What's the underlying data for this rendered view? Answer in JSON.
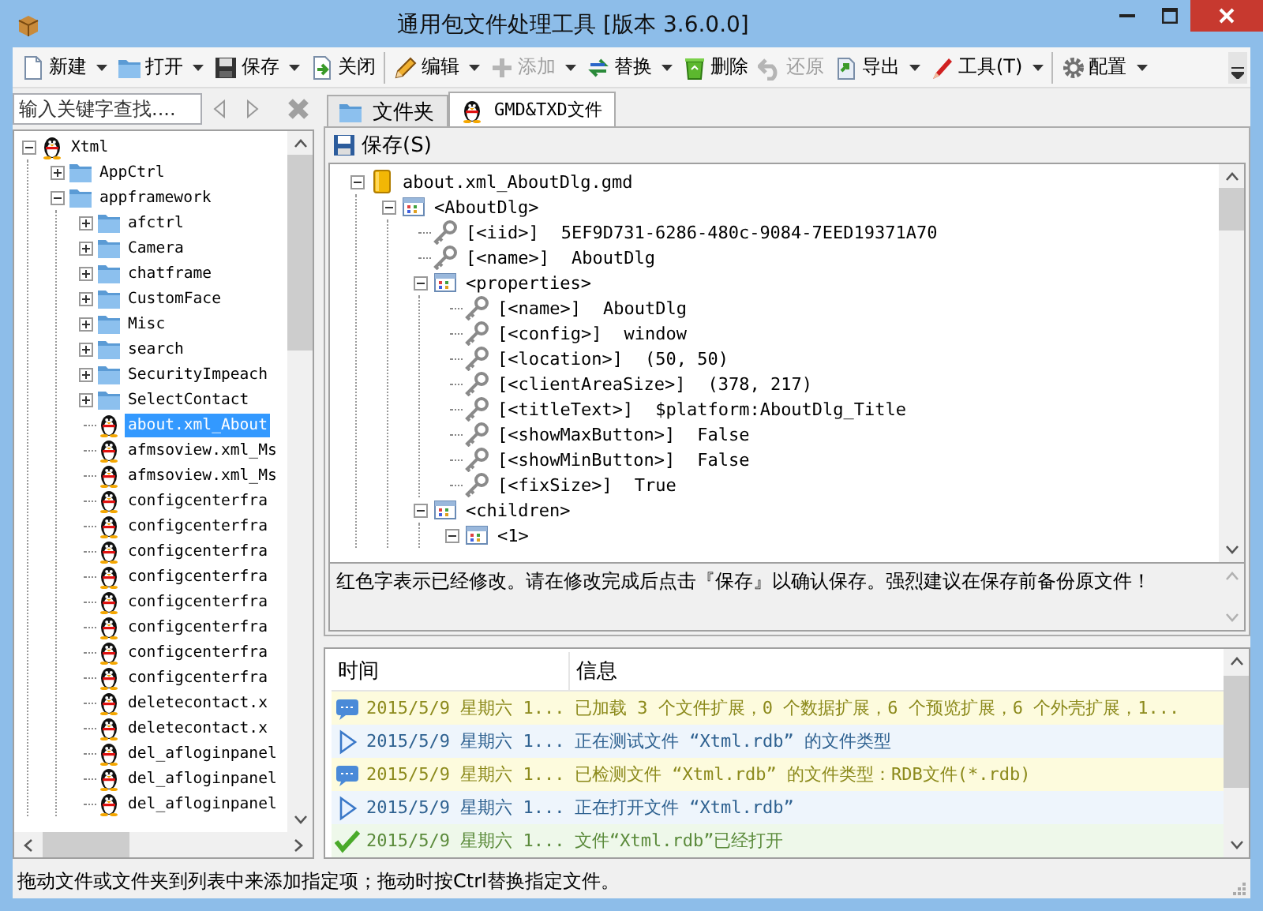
{
  "window": {
    "title": "通用包文件处理工具 [版本 3.6.0.0]"
  },
  "toolbar": {
    "groups": [
      [
        {
          "label": "新建",
          "has_menu": true,
          "disabled": false
        },
        {
          "label": "打开",
          "has_menu": true,
          "disabled": false
        },
        {
          "label": "保存",
          "has_menu": true,
          "disabled": false
        },
        {
          "label": "关闭",
          "has_menu": false,
          "disabled": false
        }
      ],
      [
        {
          "label": "编辑",
          "has_menu": true,
          "disabled": false
        },
        {
          "label": "添加",
          "has_menu": true,
          "disabled": true
        },
        {
          "label": "替换",
          "has_menu": true,
          "disabled": false
        },
        {
          "label": "删除",
          "has_menu": false,
          "disabled": false
        },
        {
          "label": "还原",
          "has_menu": false,
          "disabled": true
        },
        {
          "label": "导出",
          "has_menu": true,
          "disabled": false
        },
        {
          "label": "工具(T)",
          "has_menu": true,
          "disabled": false
        }
      ],
      [
        {
          "label": "配置",
          "has_menu": true,
          "disabled": false
        }
      ]
    ]
  },
  "search": {
    "placeholder": "输入关键字查找...."
  },
  "sidebar": {
    "tree": [
      {
        "kind": "penguin",
        "label": "Xtml",
        "expanded": true,
        "selected": false,
        "children": [
          {
            "kind": "folder",
            "label": "AppCtrl",
            "expanded": false,
            "selected": false
          },
          {
            "kind": "folder",
            "label": "appframework",
            "expanded": true,
            "selected": false,
            "children": [
              {
                "kind": "folder",
                "label": "afctrl",
                "expanded": false,
                "selected": false
              },
              {
                "kind": "folder",
                "label": "Camera",
                "expanded": false,
                "selected": false
              },
              {
                "kind": "folder",
                "label": "chatframe",
                "expanded": false,
                "selected": false
              },
              {
                "kind": "folder",
                "label": "CustomFace",
                "expanded": false,
                "selected": false
              },
              {
                "kind": "folder",
                "label": "Misc",
                "expanded": false,
                "selected": false
              },
              {
                "kind": "folder",
                "label": "search",
                "expanded": false,
                "selected": false
              },
              {
                "kind": "folder",
                "label": "SecurityImpeach",
                "expanded": false,
                "selected": false
              },
              {
                "kind": "folder",
                "label": "SelectContact",
                "expanded": false,
                "selected": false
              },
              {
                "kind": "penguin",
                "label": "about.xml_About",
                "selected": true
              },
              {
                "kind": "penguin",
                "label": "afmsoview.xml_Ms",
                "selected": false
              },
              {
                "kind": "penguin",
                "label": "afmsoview.xml_Ms",
                "selected": false
              },
              {
                "kind": "penguin",
                "label": "configcenterfra",
                "selected": false
              },
              {
                "kind": "penguin",
                "label": "configcenterfra",
                "selected": false
              },
              {
                "kind": "penguin",
                "label": "configcenterfra",
                "selected": false
              },
              {
                "kind": "penguin",
                "label": "configcenterfra",
                "selected": false
              },
              {
                "kind": "penguin",
                "label": "configcenterfra",
                "selected": false
              },
              {
                "kind": "penguin",
                "label": "configcenterfra",
                "selected": false
              },
              {
                "kind": "penguin",
                "label": "configcenterfra",
                "selected": false
              },
              {
                "kind": "penguin",
                "label": "configcenterfra",
                "selected": false
              },
              {
                "kind": "penguin",
                "label": "deletecontact.x",
                "selected": false
              },
              {
                "kind": "penguin",
                "label": "deletecontact.x",
                "selected": false
              },
              {
                "kind": "penguin",
                "label": "del_afloginpanel",
                "selected": false
              },
              {
                "kind": "penguin",
                "label": "del_afloginpanel",
                "selected": false
              },
              {
                "kind": "penguin",
                "label": "del_afloginpanel",
                "selected": false
              }
            ]
          }
        ]
      }
    ]
  },
  "tabs": [
    {
      "label": "文件夹",
      "selected": false
    },
    {
      "label": "GMD&TXD文件",
      "selected": true
    }
  ],
  "editor": {
    "save_button": "保存(S)",
    "tree": [
      {
        "kind": "file",
        "label": "about.xml_AboutDlg.gmd",
        "expanded": true,
        "selected": false,
        "children": [
          {
            "kind": "node",
            "label": "<AboutDlg>",
            "expanded": true,
            "selected": false,
            "children": [
              {
                "kind": "key",
                "label": "[<iid>]",
                "value": "5EF9D731-6286-480c-9084-7EED19371A70",
                "selected": false
              },
              {
                "kind": "key",
                "label": "[<name>]",
                "value": "AboutDlg",
                "selected": false
              },
              {
                "kind": "node",
                "label": "<properties>",
                "expanded": true,
                "selected": false,
                "children": [
                  {
                    "kind": "key",
                    "label": "[<name>]",
                    "value": "AboutDlg",
                    "selected": false
                  },
                  {
                    "kind": "key",
                    "label": "[<config>]",
                    "value": "window",
                    "selected": false
                  },
                  {
                    "kind": "key",
                    "label": "[<location>]",
                    "value": "(50, 50)",
                    "selected": false
                  },
                  {
                    "kind": "key",
                    "label": "[<clientAreaSize>]",
                    "value": "(378, 217)",
                    "selected": false
                  },
                  {
                    "kind": "key",
                    "label": "[<titleText>]",
                    "value": "$platform:AboutDlg_Title",
                    "selected": false
                  },
                  {
                    "kind": "key",
                    "label": "[<showMaxButton>]",
                    "value": "False",
                    "selected": false
                  },
                  {
                    "kind": "key",
                    "label": "[<showMinButton>]",
                    "value": "False",
                    "selected": false
                  },
                  {
                    "kind": "key",
                    "label": "[<fixSize>]",
                    "value": "True",
                    "selected": false
                  }
                ]
              },
              {
                "kind": "node",
                "label": "<children>",
                "expanded": true,
                "selected": false,
                "children": [
                  {
                    "kind": "node",
                    "label": "<1>",
                    "expanded": true,
                    "selected": false
                  }
                ]
              }
            ]
          }
        ]
      }
    ],
    "description": "红色字表示已经修改。请在修改完成后点击『保存』以确认保存。强烈建议在保存前备份原文件！"
  },
  "log": {
    "columns": [
      "时间",
      "信息"
    ],
    "rows": [
      {
        "kind": "info",
        "time": "2015/5/9 星期六 1...",
        "message": "已加载 3 个文件扩展，0 个数据扩展，6 个预览扩展，6 个外壳扩展，1..."
      },
      {
        "kind": "step",
        "time": "2015/5/9 星期六 1...",
        "message": "正在测试文件 “Xtml.rdb” 的文件类型"
      },
      {
        "kind": "info",
        "time": "2015/5/9 星期六 1...",
        "message": "已检测文件 “Xtml.rdb” 的文件类型：RDB文件(*.rdb)"
      },
      {
        "kind": "step",
        "time": "2015/5/9 星期六 1...",
        "message": "正在打开文件 “Xtml.rdb”"
      },
      {
        "kind": "success",
        "time": "2015/5/9 星期六 1...",
        "message": "文件“Xtml.rdb”已经打开"
      }
    ]
  },
  "status_bar": "拖动文件或文件夹到列表中来添加指定项；拖动时按Ctrl替换指定文件。"
}
